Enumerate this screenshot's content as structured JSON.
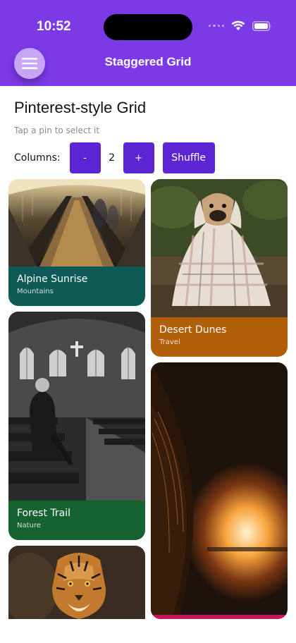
{
  "status": {
    "time": "10:52"
  },
  "app": {
    "title": "Staggered Grid"
  },
  "page": {
    "title": "Pinterest-style Grid",
    "subtitle": "Tap a pin to select it"
  },
  "controls": {
    "columns_label": "Columns:",
    "minus_label": "-",
    "columns_value": "2",
    "plus_label": "+",
    "shuffle_label": "Shuffle"
  },
  "cards": [
    {
      "title": "Alpine Sunrise",
      "subtitle": "Mountains",
      "caption_color": "#0e5a57",
      "image": "escalator-photo"
    },
    {
      "title": "Desert Dunes",
      "subtitle": "Travel",
      "caption_color": "#b15f09",
      "image": "dog-blanket-photo"
    },
    {
      "title": "Forest Trail",
      "subtitle": "Nature",
      "caption_color": "#176330",
      "image": "church-interior-photo"
    },
    {
      "title": "",
      "subtitle": "",
      "caption_color": "#c2185b",
      "image": "horse-fire-photo"
    },
    {
      "title": "",
      "subtitle": "",
      "caption_color": "",
      "image": "tiger-photo"
    }
  ],
  "colors": {
    "header": "#7b3ae6",
    "button": "#5b25d3",
    "menu_button": "#c7a6f6"
  }
}
